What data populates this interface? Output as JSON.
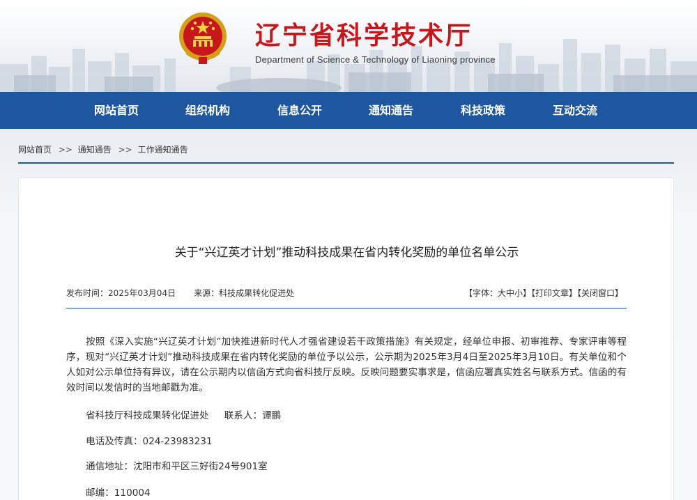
{
  "header": {
    "site_title": "辽宁省科学技术厅",
    "site_subtitle": "Department of Science & Technology of Liaoning province",
    "colors": {
      "title_red": "#c8161d",
      "nav_blue": "#1f56a0"
    }
  },
  "nav": {
    "items": [
      {
        "label": "网站首页"
      },
      {
        "label": "组织机构"
      },
      {
        "label": "信息公开"
      },
      {
        "label": "通知通告"
      },
      {
        "label": "科技政策"
      },
      {
        "label": "互动交流"
      }
    ]
  },
  "breadcrumb": {
    "items": [
      "网站首页",
      "通知通告",
      "工作通知通告"
    ],
    "separator": ">>"
  },
  "article": {
    "title": "关于“兴辽英才计划”推动科技成果在省内转化奖励的单位名单公示",
    "publish_label": "发布时间：2025年03月04日",
    "source_label": "来源：科技成果转化促进处",
    "font_size_label": "【字体：大中小】",
    "print_label": "【打印文章】",
    "close_label": "【关闭窗口】",
    "body": "按照《深入实施“兴辽英才计划”加快推进新时代人才强省建设若干政策措施》有关规定，经单位申报、初审推荐、专家评审等程序，现对“兴辽英才计划”推动科技成果在省内转化奖励的单位予以公示，公示期为2025年3月4日至2025年3月10日。有关单位和个人如对公示单位持有异议，请在公示期内以信函方式向省科技厅反映。反映问题要实事求是，信函应署真实姓名与联系方式。信函的有效时间以发信时的当地邮戳为准。",
    "dept": "省科技厅科技成果转化促进处",
    "contact": "联系人：谭鹏",
    "phone": "电话及传真：024-23983231",
    "address": "通信地址：沈阳市和平区三好街24号901室",
    "postcode": "邮编：110004"
  }
}
